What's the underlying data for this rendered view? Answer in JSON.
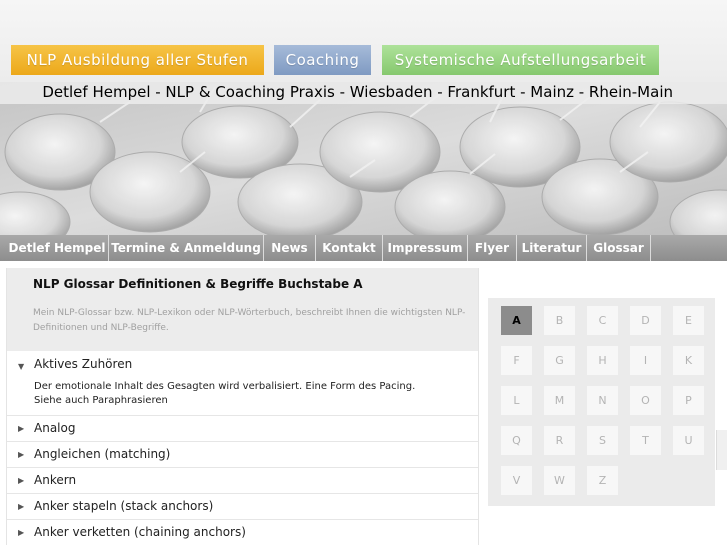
{
  "header_buttons": {
    "nlp": "NLP Ausbildung aller Stufen",
    "coaching": "Coaching",
    "systemic": "Systemische Aufstellungsarbeit"
  },
  "tagline": "Detlef Hempel - NLP & Coaching Praxis - Wiesbaden - Frankfurt - Mainz - Rhein-Main",
  "nav": [
    "Detlef Hempel",
    "Termine & Anmeldung",
    "News",
    "Kontakt",
    "Impressum",
    "Flyer",
    "Literatur",
    "Glossar"
  ],
  "intro": {
    "title": "NLP Glossar Definitionen & Begriffe Buchstabe A",
    "text": "Mein NLP-Glossar bzw. NLP-Lexikon oder NLP-Wörterbuch, beschreibt Ihnen die wichtigsten NLP-Definitionen und NLP-Begriffe."
  },
  "entries": [
    {
      "title": "Aktives Zuhören",
      "expanded": true,
      "body_line1": "Der emotionale Inhalt des Gesagten wird verbalisiert. Eine Form des Pacing.",
      "body_line2": "Siehe auch Paraphrasieren"
    },
    {
      "title": "Analog",
      "expanded": false
    },
    {
      "title": "Angleichen (matching)",
      "expanded": false
    },
    {
      "title": "Ankern",
      "expanded": false
    },
    {
      "title": "Anker stapeln (stack anchors)",
      "expanded": false
    },
    {
      "title": "Anker verketten (chaining anchors)",
      "expanded": false
    }
  ],
  "letters": [
    [
      "A",
      "B",
      "C",
      "D",
      "E"
    ],
    [
      "F",
      "G",
      "H",
      "I",
      "K"
    ],
    [
      "L",
      "M",
      "N",
      "O",
      "P"
    ],
    [
      "Q",
      "R",
      "S",
      "T",
      "U"
    ],
    [
      "V",
      "W",
      "Z"
    ]
  ],
  "active_letter": "A",
  "colors": {
    "nlp_button": "#eca81a",
    "coaching_button": "#7f9ac2",
    "systemic_button": "#86c86e",
    "nav_bar": "#8d8d8d"
  },
  "icons": {
    "expanded": "triangle-down-icon",
    "collapsed": "triangle-right-icon"
  }
}
